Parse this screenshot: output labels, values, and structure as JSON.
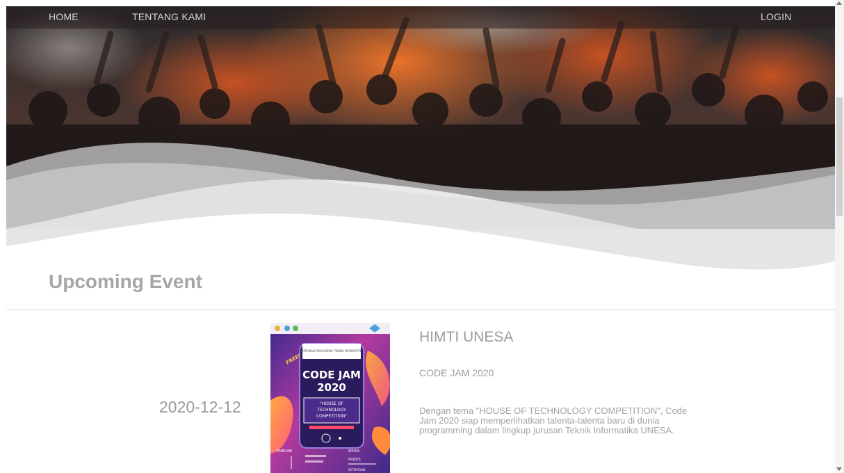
{
  "nav": {
    "home": "HOME",
    "about": "TENTANG KAMI",
    "login": "LOGIN"
  },
  "section": {
    "title": "Upcoming Event"
  },
  "event": {
    "date": "2020-12-12",
    "organizer": "HIMTI UNESA",
    "name": "CODE JAM 2020",
    "description": "Dengan tema \"HOUSE OF TECHNOLOGY COMPETITION\", Code Jam 2020 siap memperlihatkan talenta-talenta baru di dunia programming dalam lingkup jurusan Teknik Informatika UNESA.",
    "poster": {
      "badge": "FREE!",
      "title_line1": "CODE JAM",
      "title_line2": "2020",
      "theme": "\"HOUSE OF TECHNOLOGY COMPETITION\"",
      "timeline": "TIMELINE",
      "media": "MEDIA",
      "prizes": "PRIZES",
      "rules": "KETENTUAN"
    }
  },
  "colors": {
    "title": "#a6a6a6",
    "text": "#9c9c9c",
    "nav_text": "#d8d4d4"
  }
}
